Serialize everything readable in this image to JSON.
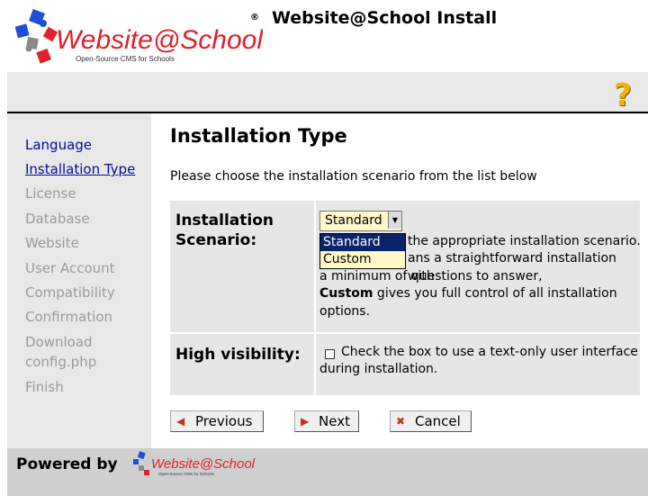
{
  "header": {
    "app_title": "Website@School Install",
    "logo_main": "Website@School",
    "logo_tagline": "Open-Source CMS for Schools",
    "registered_mark": "®"
  },
  "toolbar": {
    "help_icon": "?"
  },
  "sidebar": {
    "items": [
      {
        "label": "Language",
        "state": "active"
      },
      {
        "label": "Installation Type",
        "state": "current"
      },
      {
        "label": "License",
        "state": "disabled"
      },
      {
        "label": "Database",
        "state": "disabled"
      },
      {
        "label": "Website",
        "state": "disabled"
      },
      {
        "label": "User Account",
        "state": "disabled"
      },
      {
        "label": "Compatibility",
        "state": "disabled"
      },
      {
        "label": "Confirmation",
        "state": "disabled"
      },
      {
        "label": "Download",
        "state": "disabled"
      },
      {
        "label": "config.php",
        "state": "disabled"
      },
      {
        "label": "Finish",
        "state": "disabled"
      }
    ]
  },
  "main": {
    "heading": "Installation Type",
    "intro": "Please choose the installation scenario from the list below",
    "scenario": {
      "label_line1": "Installation",
      "label_line2": "Scenario:",
      "selected": "Standard",
      "options": [
        "Standard",
        "Custom"
      ],
      "desc_line1_tail": "the appropriate installation scenario.",
      "desc_line2_tail": "ans a straightforward installation with",
      "desc_line3": "a minimum of questions to answer,",
      "desc_custom_bold": "Custom",
      "desc_custom_rest": " gives you full control of all installation",
      "desc_line5": "options."
    },
    "high_visibility": {
      "label": "High visibility:",
      "desc_line1": "Check the box to use a text-only user interface",
      "desc_line2": "during installation."
    }
  },
  "buttons": {
    "previous": "Previous",
    "next": "Next",
    "cancel": "Cancel"
  },
  "footer": {
    "powered_by": "Powered by",
    "logo_main": "Website@School",
    "logo_tagline": "Open-Source CMS for Schools"
  }
}
